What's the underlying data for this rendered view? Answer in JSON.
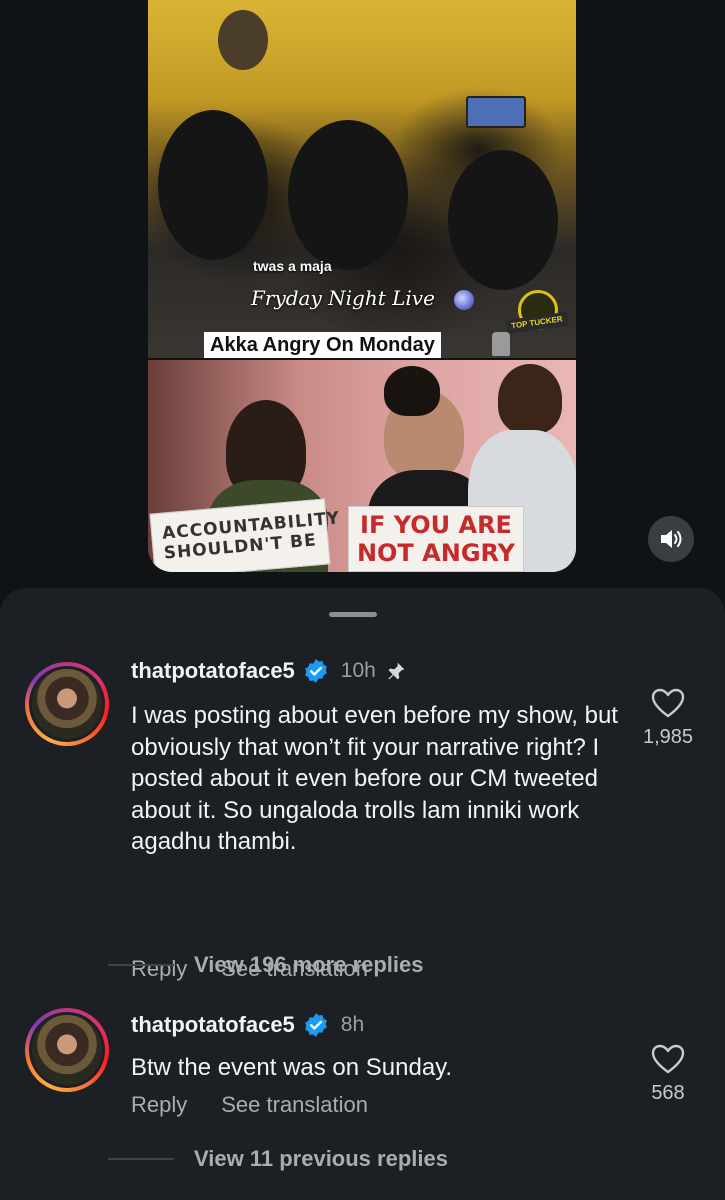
{
  "reel": {
    "overlay_small": "twas a maja",
    "overlay_script": "Fryday Night Live",
    "caption": "Akka Angry On Monday",
    "logo_text": "TOP TUCKER",
    "sign_left": "ACCOUNTABILITY SHOULDN'T BE",
    "sign_right_line1": "IF YOU ARE",
    "sign_right_line2": "NOT ANGRY"
  },
  "controls": {
    "mute_icon": "speaker-icon"
  },
  "comments": [
    {
      "username": "thatpotatoface5",
      "time": "10h",
      "pinned": true,
      "text": "I was posting about even before my show, but obviously that won’t fit your narrative right? I posted about it even before our CM tweeted about it. So ungaloda trolls lam inniki work agadhu thambi.",
      "reply_label": "Reply",
      "translate_label": "See translation",
      "likes": "1,985",
      "view_replies": "View 196 more replies"
    },
    {
      "username": "thatpotatoface5",
      "time": "8h",
      "pinned": false,
      "text": "Btw the event was on Sunday.",
      "reply_label": "Reply",
      "translate_label": "See translation",
      "likes": "568",
      "view_replies": "View 11 previous replies"
    }
  ],
  "colors": {
    "background": "#101316",
    "sheet": "#1c1f23",
    "verified": "#1d9bf0",
    "muted_text": "#a8adb3"
  }
}
